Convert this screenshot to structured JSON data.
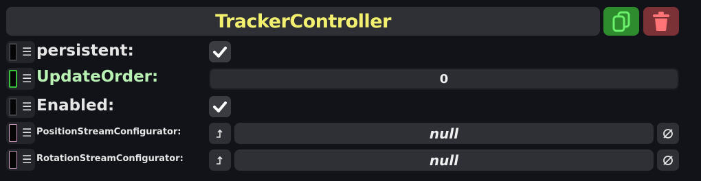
{
  "header": {
    "title": "TrackerController"
  },
  "toolbar": {
    "duplicate_icon": "copy-icon",
    "delete_icon": "trash-icon"
  },
  "fields": [
    {
      "label": "persistent:",
      "type": "checkbox",
      "checked": true,
      "handle_color": "#3e3e44"
    },
    {
      "label": "UpdateOrder:",
      "type": "number",
      "value": "0",
      "label_color": "#b9f0b3",
      "handle_color": "#38c43a"
    },
    {
      "label": "Enabled:",
      "type": "checkbox",
      "checked": true,
      "handle_color": "#3e3e44"
    },
    {
      "label": "PositionStreamConfigurator:",
      "type": "reference",
      "value": "null",
      "handle_color": "#d2a2c6"
    },
    {
      "label": "RotationStreamConfigurator:",
      "type": "reference",
      "value": "null",
      "handle_color": "#d2a2c6"
    }
  ],
  "colors": {
    "background": "#111318",
    "title": "#f3f06f",
    "duplicate_button": "#2e8b2e",
    "delete_button": "#7a3236"
  }
}
